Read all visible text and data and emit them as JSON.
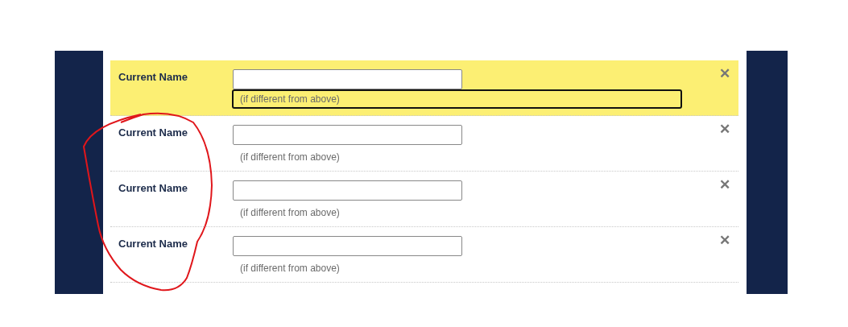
{
  "rows": [
    {
      "label": "Current Name",
      "hint": "(if different from above)",
      "highlighted": true,
      "hint_focused": true,
      "remove": "✕"
    },
    {
      "label": "Current Name",
      "hint": "(if different from above)",
      "highlighted": false,
      "hint_focused": false,
      "remove": "✕"
    },
    {
      "label": "Current Name",
      "hint": "(if different from above)",
      "highlighted": false,
      "hint_focused": false,
      "remove": "✕"
    },
    {
      "label": "Current Name",
      "hint": "(if different from above)",
      "highlighted": false,
      "hint_focused": false,
      "remove": "✕"
    }
  ]
}
